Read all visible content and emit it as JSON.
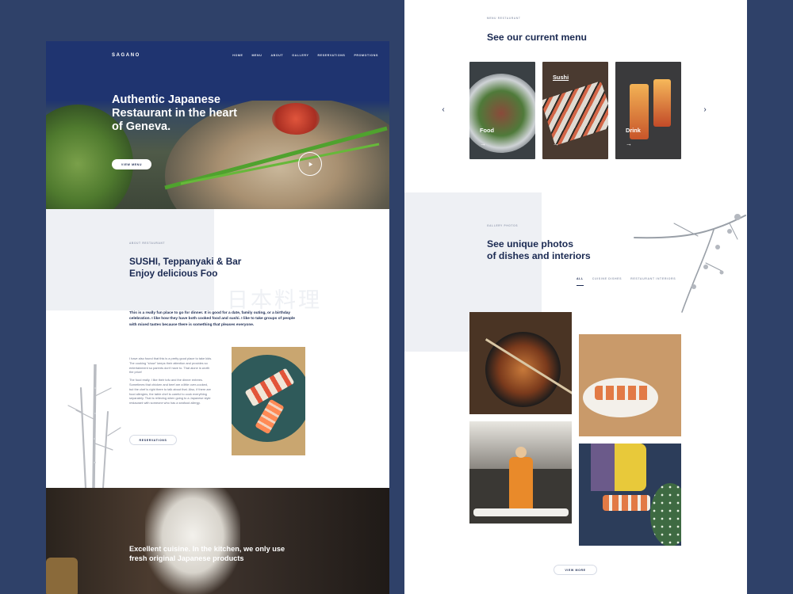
{
  "left": {
    "nav": {
      "logo": "SAGANO",
      "items": [
        "HOME",
        "MENU",
        "ABOUT",
        "GALLERY",
        "RESERVATIONS",
        "PROMOTIONS"
      ]
    },
    "hero": {
      "title": "Authentic Japanese Restaurant in the heart of Geneva.",
      "button": "VIEW MENU"
    },
    "about": {
      "kicker": "ABOUT RESTAURANT",
      "title_line1": "SUSHI, Teppanyaki & Bar",
      "title_line2": "Enjoy delicious Foo",
      "kanji": "日本料理",
      "lead": "This is a really fun place to go for dinner. It is good for a date, family outing, or a birthday celebration. I like how they have both cooked food and sushi. I like to take groups of people with mixed tastes because there is something that pleases everyone.",
      "body_p1": "I have also found that this is a pretty good place to take kids. The cooking \"show\" keeps their attention and provides so entertainment so parents don't have to. That alone is worth the price!",
      "body_p2": "The food really. I like their tofu and the dinner entrees. Sometimes that chicken and beef are a little over-cooked, but the chef is right there to talk about that. Also, if there are food allergies, the table chef is careful to cook everything separately. That is relieving when going to a Japanese style restaurant with someone who has a seafood allergy.",
      "button": "RESERVATIONS"
    },
    "kitchen": {
      "text": "Excellent cuisine. In the kitchen, we only use fresh original Japanese products"
    }
  },
  "right": {
    "menu": {
      "kicker": "MENU RESTAURANT",
      "title": "See our current menu",
      "cards": [
        {
          "label": "Food",
          "arrow": "→"
        },
        {
          "label": "Sushi",
          "arrow": "→"
        },
        {
          "label": "Drink",
          "arrow": "→"
        }
      ],
      "prev": "‹",
      "next": "›"
    },
    "gallery": {
      "kicker": "GALLERY PHOTOS",
      "title_line1": "See unique photos",
      "title_line2": "of dishes and interiors",
      "filters": [
        "ALL",
        "CUISINE DISHES",
        "RESTAURANT INTERIORS"
      ],
      "button": "VIEW MORE"
    }
  },
  "colors": {
    "background": "#2f4169",
    "navy": "#1f3470",
    "text": "#1b2a52",
    "muted": "#9aa2b5",
    "panel": "#eef0f4"
  }
}
